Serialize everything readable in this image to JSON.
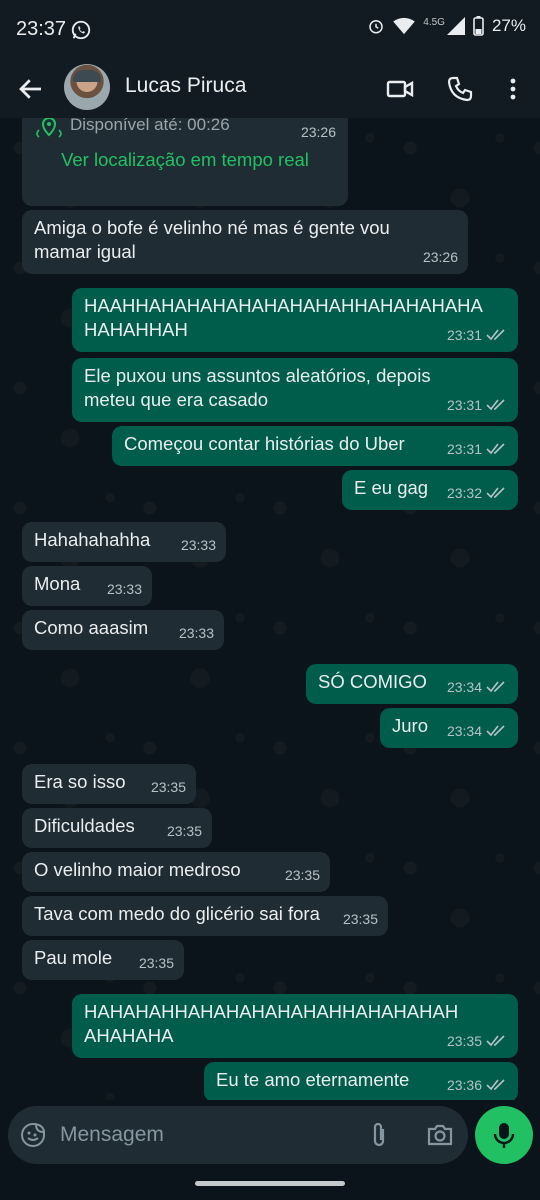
{
  "status_bar": {
    "time": "23:37",
    "network": "4.5G",
    "battery": "27%"
  },
  "header": {
    "contact_name": "Lucas Piruca"
  },
  "location_card": {
    "status": "Disponível até: 00:26",
    "time": "23:26",
    "link": "Ver localização em tempo real"
  },
  "messages": [
    {
      "dir": "in",
      "text": "Amiga o bofe é velinho né mas é gente vou\nmamar igual",
      "time": "23:26"
    },
    {
      "dir": "out",
      "text": "HAAHHAHAHAHAHAHAHAHAHHAHAHAHAHA\nHAHAHHAH",
      "time": "23:31"
    },
    {
      "dir": "out",
      "text": "Ele puxou uns assuntos aleatórios, depois\nmeteu que era casado",
      "time": "23:31"
    },
    {
      "dir": "out",
      "text": "Começou contar histórias do Uber",
      "time": "23:31"
    },
    {
      "dir": "out",
      "text": "E eu gag",
      "time": "23:32"
    },
    {
      "dir": "in",
      "text": "Hahahahahha",
      "time": "23:33"
    },
    {
      "dir": "in",
      "text": "Mona",
      "time": "23:33"
    },
    {
      "dir": "in",
      "text": "Como aaasim",
      "time": "23:33"
    },
    {
      "dir": "out",
      "text": "SÓ COMIGO",
      "time": "23:34"
    },
    {
      "dir": "out",
      "text": "Juro",
      "time": "23:34"
    },
    {
      "dir": "in",
      "text": "Era so isso",
      "time": "23:35"
    },
    {
      "dir": "in",
      "text": "Dificuldades",
      "time": "23:35"
    },
    {
      "dir": "in",
      "text": "O velinho maior medroso",
      "time": "23:35"
    },
    {
      "dir": "in",
      "text": "Tava com medo do glicério sai fora",
      "time": "23:35"
    },
    {
      "dir": "in",
      "text": "Pau mole",
      "time": "23:35"
    },
    {
      "dir": "out",
      "text": "HAHAHAHHAHAHAHAHAHAHHAHAHAHAH\nAHAHAHA",
      "time": "23:35"
    },
    {
      "dir": "out",
      "text": "Eu te amo eternamente",
      "time": "23:36"
    }
  ],
  "input": {
    "placeholder": "Mensagem"
  },
  "colors": {
    "incoming_bubble": "#202c33",
    "outgoing_bubble": "#005c4b",
    "accent": "#21c063",
    "background": "#0b141a"
  },
  "icons": [
    "back-arrow-icon",
    "video-call-icon",
    "phone-icon",
    "more-options-icon",
    "location-pin-icon",
    "read-ticks-icon",
    "emoji-sticker-icon",
    "attach-icon",
    "camera-icon",
    "mic-icon"
  ]
}
